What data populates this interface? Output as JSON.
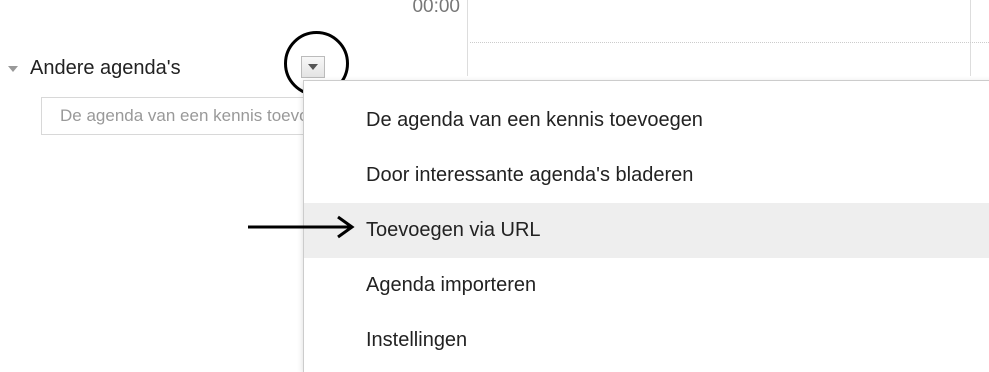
{
  "calendar": {
    "time_label": "00:00"
  },
  "sidebar": {
    "section_title": "Andere agenda's",
    "friend_input_placeholder": "De agenda van een kennis toevoegen"
  },
  "menu": {
    "items": [
      "De agenda van een kennis toevoegen",
      "Door interessante agenda's bladeren",
      "Toevoegen via URL",
      "Agenda importeren",
      "Instellingen"
    ],
    "hovered_item": "Toevoegen via URL"
  },
  "annotations": {
    "circle_color": "#000000",
    "arrow_color": "#000000"
  },
  "icons": {
    "collapse": "triangle-down-icon",
    "menu_caret": "chevron-down-icon",
    "pointer_arrow": "arrow-right-icon"
  }
}
